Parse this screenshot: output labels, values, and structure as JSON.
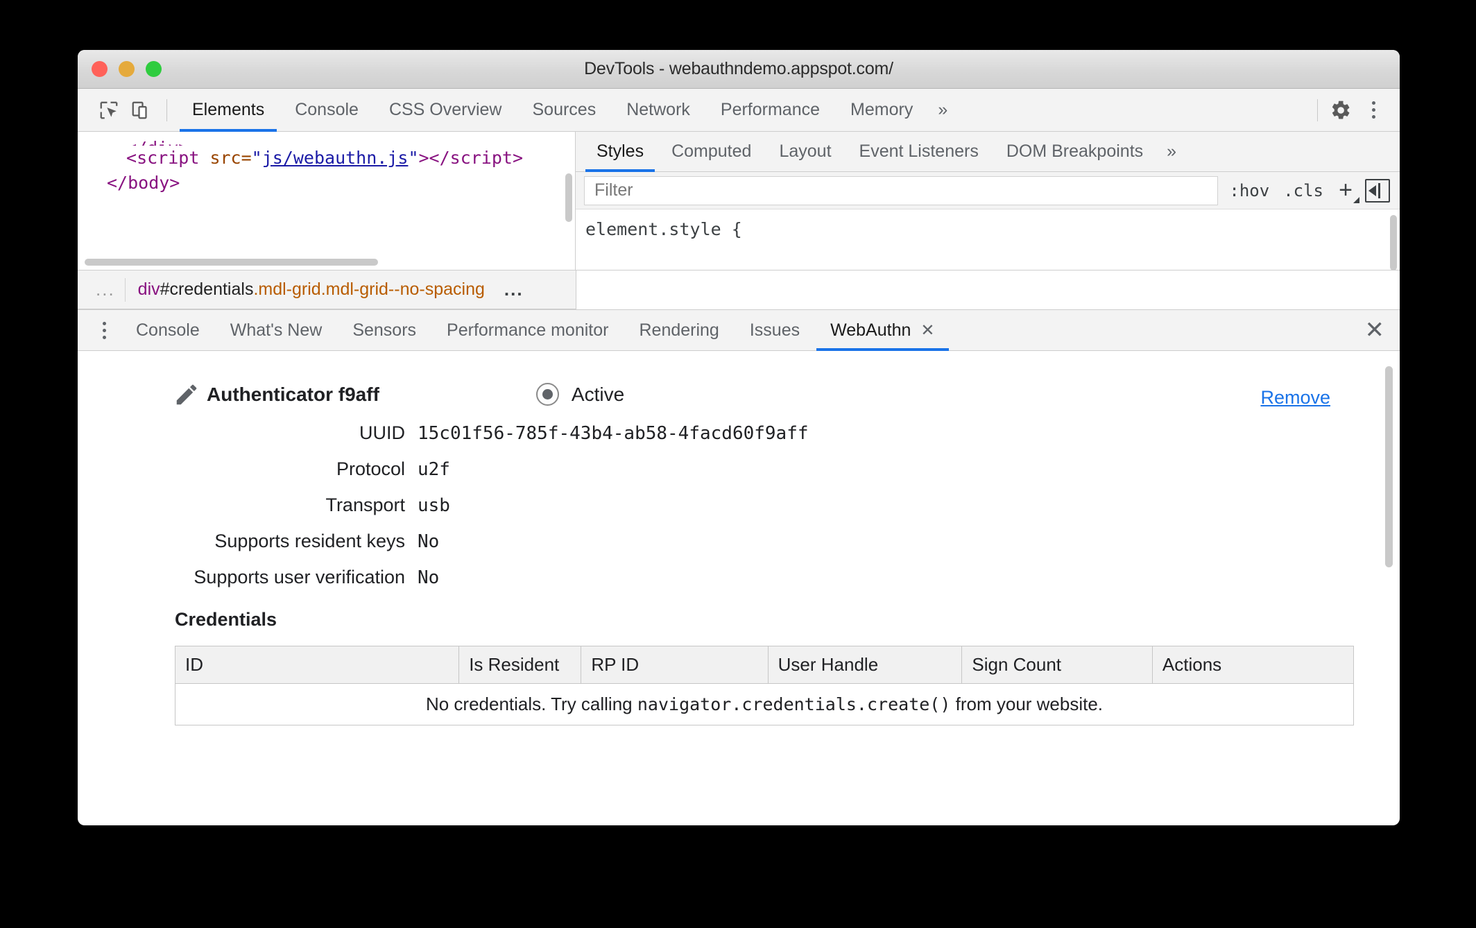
{
  "window": {
    "title": "DevTools - webauthndemo.appspot.com/",
    "traffic_lights": [
      "close",
      "minimize",
      "maximize"
    ],
    "colors": {
      "accent": "#1a73e8",
      "link": "#1a73e8",
      "tag": "#881280",
      "class": "#b85c00"
    }
  },
  "main_toolbar": {
    "inspect_icon": "inspect-element-icon",
    "device_icon": "device-toolbar-icon",
    "tabs": [
      {
        "label": "Elements",
        "active": true
      },
      {
        "label": "Console",
        "active": false
      },
      {
        "label": "CSS Overview",
        "active": false
      },
      {
        "label": "Sources",
        "active": false
      },
      {
        "label": "Network",
        "active": false
      },
      {
        "label": "Performance",
        "active": false
      },
      {
        "label": "Memory",
        "active": false
      }
    ],
    "more_tabs": "»",
    "settings_icon": "gear-icon",
    "menu_icon": "kebab-menu-icon"
  },
  "elements_panel": {
    "dom": {
      "line1": {
        "text": "</div>"
      },
      "line2": {
        "open": "<",
        "tag": "script",
        "attr": "src",
        "eq": "=",
        "quote": "\"",
        "value": "js/webauthn.js",
        "close_open": "></",
        "tag2": "script",
        "close": ">"
      },
      "line3": {
        "text": "</body>"
      }
    },
    "breadcrumb": {
      "left_ellipsis": "...",
      "tag": "div",
      "id": "#credentials",
      "classes": ".mdl-grid.mdl-grid--no-spacing",
      "right_ellipsis": "..."
    }
  },
  "styles_panel": {
    "tabs": [
      {
        "label": "Styles",
        "active": true
      },
      {
        "label": "Computed",
        "active": false
      },
      {
        "label": "Layout",
        "active": false
      },
      {
        "label": "Event Listeners",
        "active": false
      },
      {
        "label": "DOM Breakpoints",
        "active": false
      }
    ],
    "more_tabs": "»",
    "filter_placeholder": "Filter",
    "filter_value": "",
    "hov_label": ":hov",
    "cls_label": ".cls",
    "new_rule_label": "+",
    "sidebar_toggle": "toggle-computed-sidebar-icon",
    "rule": "element.style {"
  },
  "drawer": {
    "menu_icon": "kebab-menu-icon",
    "tabs": [
      {
        "label": "Console",
        "active": false,
        "closable": false
      },
      {
        "label": "What's New",
        "active": false,
        "closable": false
      },
      {
        "label": "Sensors",
        "active": false,
        "closable": false
      },
      {
        "label": "Performance monitor",
        "active": false,
        "closable": false
      },
      {
        "label": "Rendering",
        "active": false,
        "closable": false
      },
      {
        "label": "Issues",
        "active": false,
        "closable": false
      },
      {
        "label": "WebAuthn",
        "active": true,
        "closable": true,
        "close_glyph": "✕"
      }
    ],
    "close_drawer_glyph": "✕"
  },
  "webauthn": {
    "edit_icon": "pencil-edit-icon",
    "authenticator_title": "Authenticator f9aff",
    "active_radio_label": "Active",
    "active_selected": true,
    "remove_label": "Remove",
    "properties": [
      {
        "label": "UUID",
        "value": "15c01f56-785f-43b4-ab58-4facd60f9aff"
      },
      {
        "label": "Protocol",
        "value": "u2f"
      },
      {
        "label": "Transport",
        "value": "usb"
      },
      {
        "label": "Supports resident keys",
        "value": "No"
      },
      {
        "label": "Supports user verification",
        "value": "No"
      }
    ],
    "credentials_heading": "Credentials",
    "credentials_table": {
      "columns": [
        "ID",
        "Is Resident",
        "RP ID",
        "User Handle",
        "Sign Count",
        "Actions"
      ],
      "rows": [],
      "empty_message_prefix": "No credentials. Try calling ",
      "empty_message_code": "navigator.credentials.create()",
      "empty_message_suffix": " from your website."
    }
  }
}
